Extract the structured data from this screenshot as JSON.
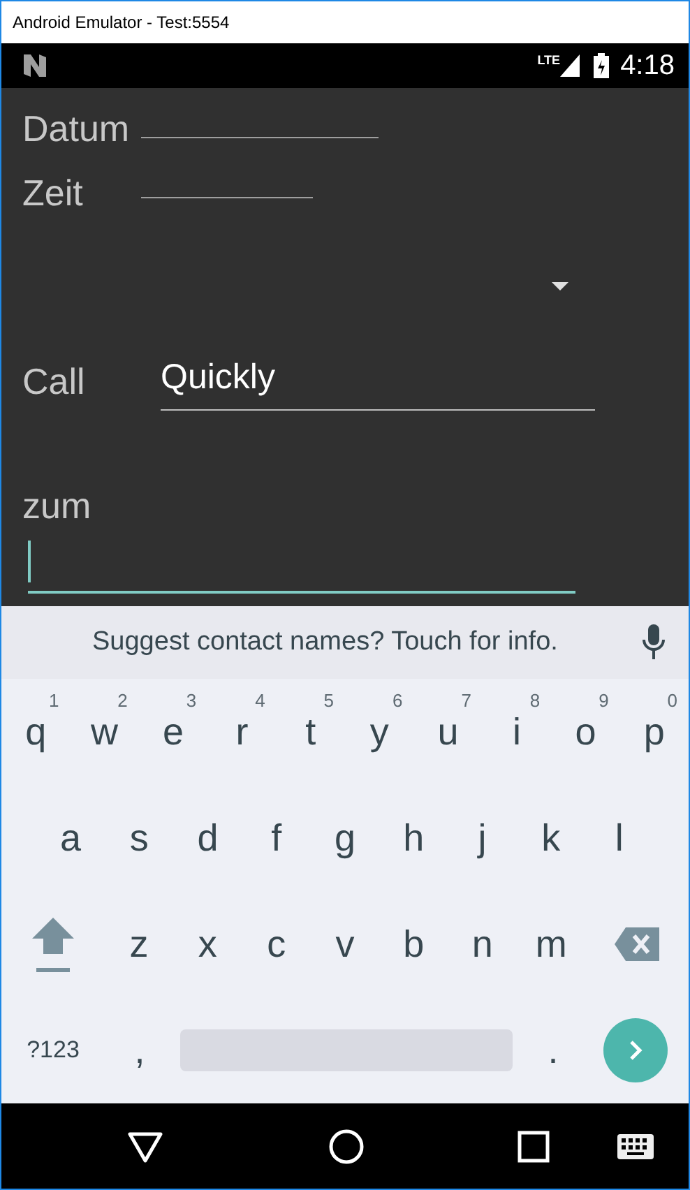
{
  "window": {
    "title": "Android Emulator - Test:5554"
  },
  "status_bar": {
    "network": "LTE",
    "time": "4:18"
  },
  "form": [
    {
      "kind": "date",
      "label": "Datum"
    },
    {
      "kind": "time",
      "label": "Zeit"
    },
    {
      "kind": "spinner"
    },
    {
      "kind": "entry",
      "label": "Call",
      "value": "Quickly",
      "focused": false
    },
    {
      "kind": "entry-below",
      "label": "zum",
      "focused": true
    }
  ],
  "keyboard": {
    "suggestion": "Suggest contact names? Touch for info.",
    "rows": [
      [
        {
          "kind": "letter",
          "label": "q",
          "hint": "1"
        },
        {
          "kind": "letter",
          "label": "w",
          "hint": "2"
        },
        {
          "kind": "letter",
          "label": "e",
          "hint": "3"
        },
        {
          "kind": "letter",
          "label": "r",
          "hint": "4"
        },
        {
          "kind": "letter",
          "label": "t",
          "hint": "5"
        },
        {
          "kind": "letter",
          "label": "y",
          "hint": "6"
        },
        {
          "kind": "letter",
          "label": "u",
          "hint": "7"
        },
        {
          "kind": "letter",
          "label": "i",
          "hint": "8"
        },
        {
          "kind": "letter",
          "label": "o",
          "hint": "9"
        },
        {
          "kind": "letter",
          "label": "p",
          "hint": "0"
        }
      ],
      [
        {
          "kind": "letter",
          "label": "a"
        },
        {
          "kind": "letter",
          "label": "s"
        },
        {
          "kind": "letter",
          "label": "d"
        },
        {
          "kind": "letter",
          "label": "f"
        },
        {
          "kind": "letter",
          "label": "g"
        },
        {
          "kind": "letter",
          "label": "h"
        },
        {
          "kind": "letter",
          "label": "j"
        },
        {
          "kind": "letter",
          "label": "k"
        },
        {
          "kind": "letter",
          "label": "l"
        }
      ],
      [
        {
          "kind": "shift"
        },
        {
          "kind": "letter",
          "label": "z"
        },
        {
          "kind": "letter",
          "label": "x"
        },
        {
          "kind": "letter",
          "label": "c"
        },
        {
          "kind": "letter",
          "label": "v"
        },
        {
          "kind": "letter",
          "label": "b"
        },
        {
          "kind": "letter",
          "label": "n"
        },
        {
          "kind": "letter",
          "label": "m"
        },
        {
          "kind": "backspace"
        }
      ]
    ],
    "bottom_row": [
      {
        "kind": "symbols",
        "label": "?123"
      },
      {
        "kind": "letter",
        "label": ","
      },
      {
        "kind": "space"
      },
      {
        "kind": "letter",
        "label": "."
      },
      {
        "kind": "enter"
      }
    ]
  }
}
